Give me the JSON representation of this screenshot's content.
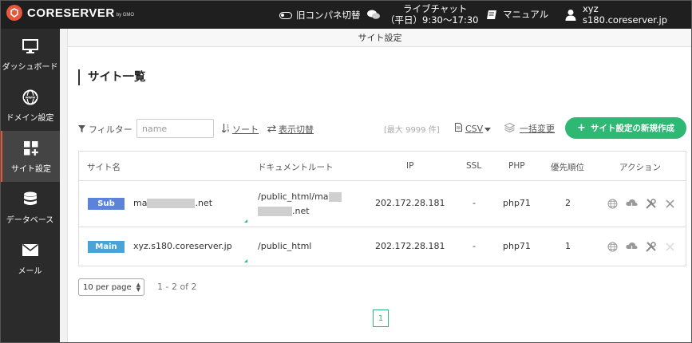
{
  "header": {
    "logo_text": "CORESERVER",
    "logo_sub": "by GMO",
    "legacy_toggle": "旧コンパネ切替",
    "live_chat_title": "ライブチャット",
    "live_chat_hours": "（平日）9:30～17:30",
    "manual": "マニュアル",
    "user_name": "xyz",
    "user_host": "s180.coreserver.jp"
  },
  "sidebar": {
    "items": [
      {
        "label": "ダッシュボード",
        "icon": "monitor-icon"
      },
      {
        "label": "ドメイン設定",
        "icon": "www-globe-icon"
      },
      {
        "label": "サイト設定",
        "icon": "grid-plus-icon",
        "active": true
      },
      {
        "label": "データベース",
        "icon": "database-icon"
      },
      {
        "label": "メール",
        "icon": "mail-icon"
      }
    ],
    "active_color": "#e8573c"
  },
  "page": {
    "strip_title": "サイト設定",
    "heading": "サイト一覧"
  },
  "toolbar": {
    "filter_label": "フィルター",
    "filter_placeholder": "name",
    "sort_label": "ソート",
    "display_toggle": "表示切替",
    "max_label": "[最大 9999 件]",
    "csv_label": "CSV",
    "bulk_change": "一括変更",
    "new_button": "サイト設定の新規作成",
    "new_button_color": "#2eb873"
  },
  "table": {
    "headers": {
      "site_name": "サイト名",
      "doc_root": "ドキュメントルート",
      "ip": "IP",
      "ssl": "SSL",
      "php": "PHP",
      "priority": "優先順位",
      "action": "アクション"
    },
    "rows": [
      {
        "badge": "Sub",
        "name_prefix": "ma",
        "name_suffix": ".net",
        "docroot_line1": "/public_html/ma",
        "docroot_line2_suffix": ".net",
        "ip": "202.172.28.181",
        "ssl": "-",
        "php": "php71",
        "priority": "2"
      },
      {
        "badge": "Main",
        "name": "xyz.s180.coreserver.jp",
        "docroot": "/public_html",
        "ip": "202.172.28.181",
        "ssl": "-",
        "php": "php71",
        "priority": "1"
      }
    ]
  },
  "pagination": {
    "per_page": "10 per page",
    "range": "1 - 2 of 2",
    "current_page": "1"
  }
}
